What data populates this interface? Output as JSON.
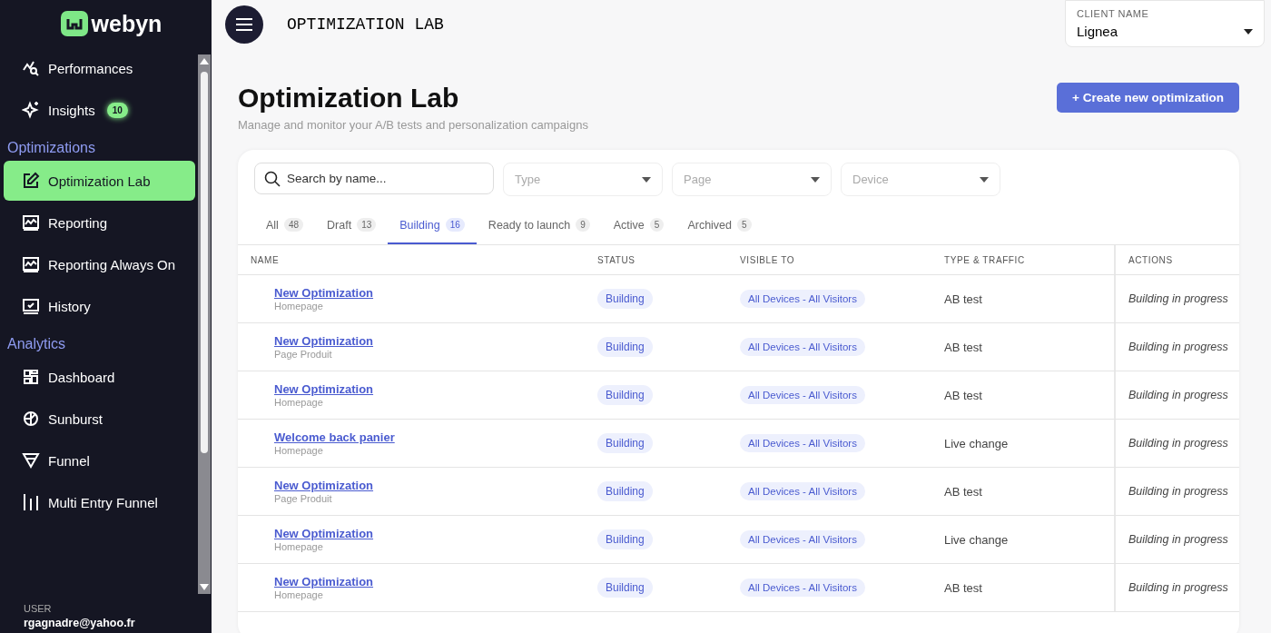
{
  "sidebar": {
    "logo": "webyn",
    "nav": [
      {
        "kind": "link",
        "label": "Performances",
        "selected": false
      },
      {
        "kind": "link",
        "label": "Insights",
        "selected": false,
        "badge": "10"
      },
      {
        "kind": "heading",
        "label": "Optimizations"
      },
      {
        "kind": "link",
        "label": "Optimization Lab",
        "selected": true
      },
      {
        "kind": "link",
        "label": "Reporting",
        "selected": false
      },
      {
        "kind": "link",
        "label": "Reporting Always On",
        "selected": false
      },
      {
        "kind": "link",
        "label": "History",
        "selected": false
      },
      {
        "kind": "heading",
        "label": "Analytics"
      },
      {
        "kind": "link",
        "label": "Dashboard",
        "selected": false
      },
      {
        "kind": "link",
        "label": "Sunburst",
        "selected": false
      },
      {
        "kind": "link",
        "label": "Funnel",
        "selected": false
      },
      {
        "kind": "link",
        "label": "Multi Entry Funnel",
        "selected": false
      }
    ],
    "user": {
      "label": "USER",
      "email": "rgagnadre@yahoo.fr"
    }
  },
  "header": {
    "title": "OPTIMIZATION LAB",
    "client": {
      "label": "CLIENT NAME",
      "value": "Lignea"
    }
  },
  "page": {
    "title": "Optimization Lab",
    "subtitle": "Manage and monitor your A/B tests and personalization campaigns",
    "create_button": "+ Create new optimization"
  },
  "filters": {
    "search": {
      "placeholder": "Search by name..."
    },
    "dropdowns": [
      {
        "placeholder": "Type"
      },
      {
        "placeholder": "Page"
      },
      {
        "placeholder": "Device"
      }
    ]
  },
  "tabs": [
    {
      "label": "All",
      "count": "48",
      "selected": false
    },
    {
      "label": "Draft",
      "count": "13",
      "selected": false
    },
    {
      "label": "Building",
      "count": "16",
      "selected": true
    },
    {
      "label": "Ready to launch",
      "count": "9",
      "selected": false
    },
    {
      "label": "Active",
      "count": "5",
      "selected": false
    },
    {
      "label": "Archived",
      "count": "5",
      "selected": false
    }
  ],
  "table": {
    "columns": [
      "NAME",
      "STATUS",
      "VISIBLE TO",
      "TYPE & TRAFFIC",
      "ACTIONS"
    ],
    "rows": [
      {
        "name": "New Optimization",
        "page": "Homepage",
        "status": "Building",
        "visible_to": "All Devices - All Visitors",
        "type": "AB test",
        "action": "Building in progress"
      },
      {
        "name": "New Optimization",
        "page": "Page Produit",
        "status": "Building",
        "visible_to": "All Devices - All Visitors",
        "type": "AB test",
        "action": "Building in progress"
      },
      {
        "name": "New Optimization",
        "page": "Homepage",
        "status": "Building",
        "visible_to": "All Devices - All Visitors",
        "type": "AB test",
        "action": "Building in progress"
      },
      {
        "name": "Welcome back panier",
        "page": "Homepage",
        "status": "Building",
        "visible_to": "All Devices - All Visitors",
        "type": "Live change",
        "action": "Building in progress"
      },
      {
        "name": "New Optimization",
        "page": "Page Produit",
        "status": "Building",
        "visible_to": "All Devices - All Visitors",
        "type": "AB test",
        "action": "Building in progress"
      },
      {
        "name": "New Optimization",
        "page": "Homepage",
        "status": "Building",
        "visible_to": "All Devices - All Visitors",
        "type": "Live change",
        "action": "Building in progress"
      },
      {
        "name": "New Optimization",
        "page": "Homepage",
        "status": "Building",
        "visible_to": "All Devices - All Visitors",
        "type": "AB test",
        "action": "Building in progress"
      }
    ]
  }
}
